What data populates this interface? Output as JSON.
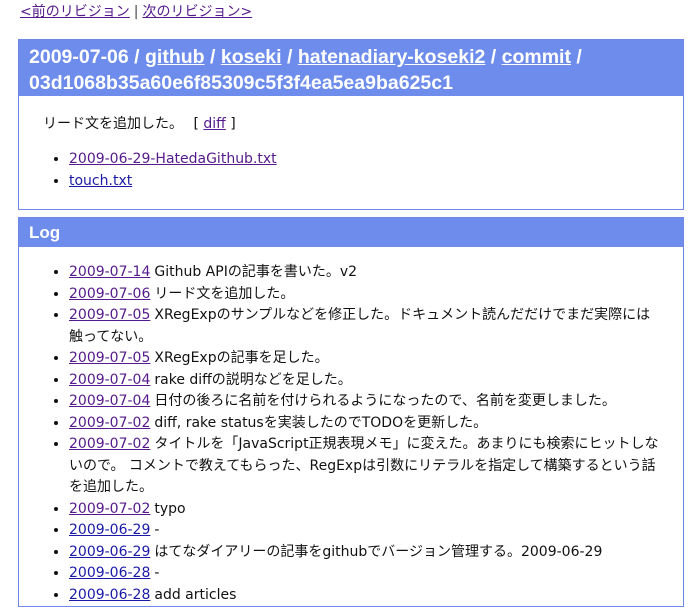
{
  "nav": {
    "prev_label": "<前のリビジョン",
    "separator": "|",
    "next_label": "次のリビジョン>"
  },
  "commit": {
    "date": "2009-07-06",
    "sep": "/",
    "crumbs": [
      "github",
      "koseki",
      "hatenadiary-koseki2",
      "commit"
    ],
    "hash": "03d1068b35a60e6f85309c5f3f4ea5ea9ba625c1",
    "message": "リード文を追加した。",
    "diff_open": "[",
    "diff_label": "diff",
    "diff_close": "]",
    "files": [
      "2009-06-29-HatedaGithub.txt",
      "touch.txt"
    ]
  },
  "log": {
    "title": "Log",
    "entries": [
      {
        "date": "2009-07-14",
        "text": "Github APIの記事を書いた。v2"
      },
      {
        "date": "2009-07-06",
        "text": "リード文を追加した。"
      },
      {
        "date": "2009-07-05",
        "text": "XRegExpのサンプルなどを修正した。ドキュメント読んだだけでまだ実際には触ってない。"
      },
      {
        "date": "2009-07-05",
        "text": "XRegExpの記事を足した。"
      },
      {
        "date": "2009-07-04",
        "text": "rake diffの説明などを足した。"
      },
      {
        "date": "2009-07-04",
        "text": "日付の後ろに名前を付けられるようになったので、名前を変更しました。"
      },
      {
        "date": "2009-07-02",
        "text": "diff, rake statusを実装したのでTODOを更新した。"
      },
      {
        "date": "2009-07-02",
        "text": "タイトルを「JavaScript正規表現メモ」に変えた。あまりにも検索にヒットしないので。 コメントで教えてもらった、RegExpは引数にリテラルを指定して構築するという話を追加した。"
      },
      {
        "date": "2009-07-02",
        "text": "typo"
      },
      {
        "date": "2009-06-29",
        "text": "-"
      },
      {
        "date": "2009-06-29",
        "text": "はてなダイアリーの記事をgithubでバージョン管理する。2009-06-29"
      },
      {
        "date": "2009-06-28",
        "text": "-"
      },
      {
        "date": "2009-06-28",
        "text": "add articles"
      }
    ]
  }
}
